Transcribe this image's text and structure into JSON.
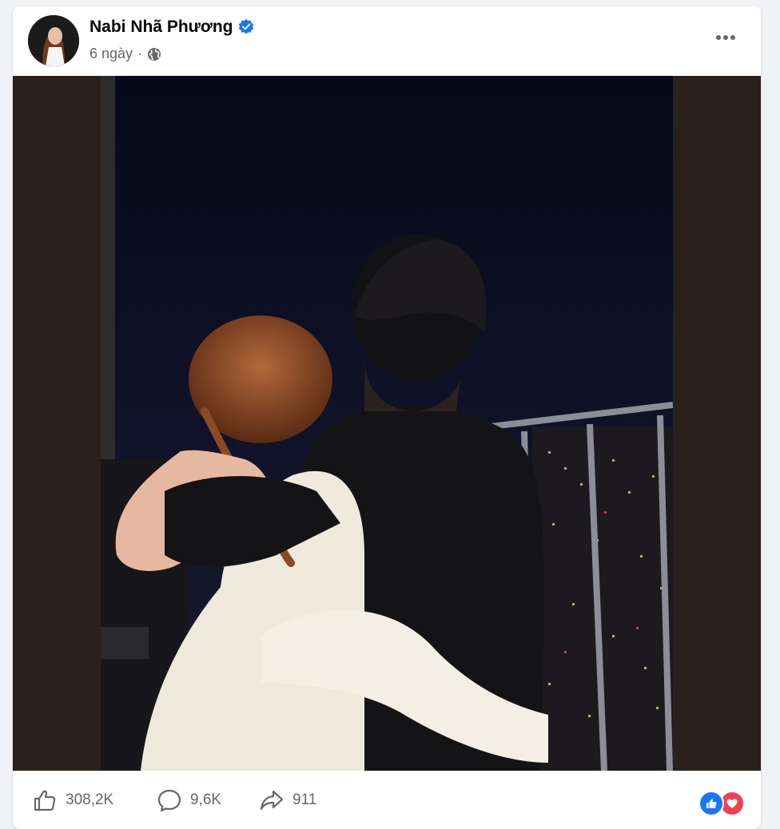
{
  "post": {
    "author_name": "Nabi Nhã Phương",
    "time_ago": "6 ngày",
    "separator": "·",
    "privacy_icon": "globe-icon",
    "verified_icon": "verified-badge-icon",
    "more_icon": "more-options-icon"
  },
  "stats": {
    "likes": "308,2K",
    "comments": "9,6K",
    "shares": "911"
  },
  "colors": {
    "accent_blue": "#1877f2",
    "love_red": "#f33e58",
    "secondary_text": "#65676b"
  }
}
